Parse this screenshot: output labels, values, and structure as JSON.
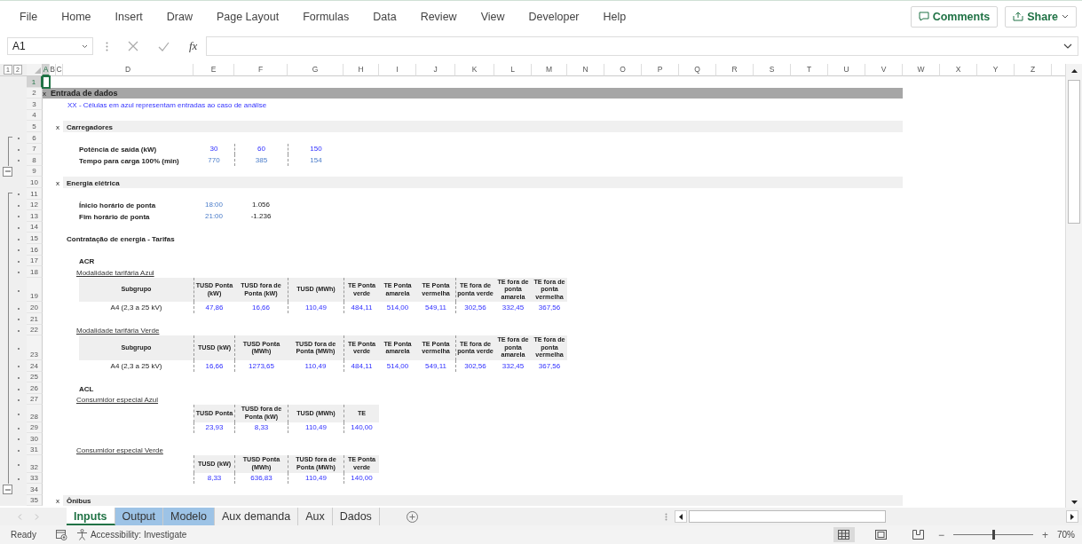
{
  "ribbon": {
    "tabs": [
      {
        "label": "File",
        "selected": false
      },
      {
        "label": "Home",
        "selected": false
      },
      {
        "label": "Insert",
        "selected": false
      },
      {
        "label": "Draw",
        "selected": false
      },
      {
        "label": "Page Layout",
        "selected": false
      },
      {
        "label": "Formulas",
        "selected": false
      },
      {
        "label": "Data",
        "selected": false
      },
      {
        "label": "Review",
        "selected": false
      },
      {
        "label": "View",
        "selected": false
      },
      {
        "label": "Developer",
        "selected": false
      },
      {
        "label": "Help",
        "selected": false
      }
    ],
    "comments": "Comments",
    "share": "Share"
  },
  "formula_bar": {
    "name_box": "A1",
    "function_label": "fx"
  },
  "sheet": {
    "outline_levels": [
      "1",
      "2"
    ],
    "columns": [
      {
        "label": "A",
        "selected": true
      },
      {
        "label": "B",
        "selected": false
      },
      {
        "label": "C",
        "selected": false
      },
      {
        "label": "D",
        "selected": false
      },
      {
        "label": "E",
        "selected": false
      },
      {
        "label": "F",
        "selected": false
      },
      {
        "label": "G",
        "selected": false
      },
      {
        "label": "H",
        "selected": false
      },
      {
        "label": "I",
        "selected": false
      },
      {
        "label": "J",
        "selected": false
      },
      {
        "label": "K",
        "selected": false
      },
      {
        "label": "L",
        "selected": false
      },
      {
        "label": "M",
        "selected": false
      },
      {
        "label": "N",
        "selected": false
      },
      {
        "label": "O",
        "selected": false
      },
      {
        "label": "P",
        "selected": false
      },
      {
        "label": "Q",
        "selected": false
      },
      {
        "label": "R",
        "selected": false
      },
      {
        "label": "S",
        "selected": false
      },
      {
        "label": "T",
        "selected": false
      },
      {
        "label": "U",
        "selected": false
      },
      {
        "label": "V",
        "selected": false
      },
      {
        "label": "W",
        "selected": false
      },
      {
        "label": "X",
        "selected": false
      },
      {
        "label": "Y",
        "selected": false
      },
      {
        "label": "Z",
        "selected": false
      }
    ],
    "rows": [
      {
        "number": "1",
        "selected": true
      },
      {
        "number": "2",
        "selected": false,
        "band": true,
        "cells": {
          "A": {
            "text": "x",
            "kind": "marker"
          },
          "B": {
            "text": "Entrada de dados",
            "kind": "title"
          }
        }
      },
      {
        "number": "3",
        "selected": false,
        "cells": {
          "D": {
            "text": "XX - Células em azul representam entradas ao caso de análise",
            "kind": "note"
          }
        }
      },
      {
        "number": "4",
        "selected": false
      },
      {
        "number": "5",
        "selected": false,
        "band": true,
        "cells": {
          "C": {
            "text": "x",
            "kind": "marker"
          },
          "D": {
            "text": "Carregadores",
            "kind": "heading"
          }
        }
      },
      {
        "number": "6",
        "selected": false,
        "grouped": true
      },
      {
        "number": "7",
        "selected": false,
        "grouped": true,
        "cells": {
          "D": {
            "text": "Potência de saída (kW)",
            "kind": "label",
            "indent": true
          },
          "E": {
            "text": "30",
            "kind": "input"
          },
          "F": {
            "text": "60",
            "kind": "input",
            "divider": true
          },
          "G": {
            "text": "150",
            "kind": "input",
            "divider": true
          }
        }
      },
      {
        "number": "8",
        "selected": false,
        "grouped": true,
        "cells": {
          "D": {
            "text": "Tempo para carga 100% (min)",
            "kind": "label",
            "indent": true
          },
          "E": {
            "text": "770",
            "kind": "calc"
          },
          "F": {
            "text": "385",
            "kind": "calc",
            "divider": true
          },
          "G": {
            "text": "154",
            "kind": "calc",
            "divider": true
          }
        }
      },
      {
        "number": "9",
        "selected": false,
        "group_toggle": true
      },
      {
        "number": "10",
        "selected": false,
        "band": true,
        "cells": {
          "C": {
            "text": "x",
            "kind": "marker"
          },
          "D": {
            "text": "Energia elétrica",
            "kind": "heading"
          }
        }
      },
      {
        "number": "11",
        "selected": false,
        "grouped": true
      },
      {
        "number": "12",
        "selected": false,
        "grouped": true,
        "cells": {
          "D": {
            "text": "Ínicio horário de ponta",
            "kind": "label",
            "indent": true
          },
          "E": {
            "text": "18:00",
            "kind": "calc"
          },
          "F": {
            "text": "1.056",
            "kind": "value"
          }
        }
      },
      {
        "number": "13",
        "selected": false,
        "grouped": true,
        "cells": {
          "D": {
            "text": "Fim horário de ponta",
            "kind": "label",
            "indent": true
          },
          "E": {
            "text": "21:00",
            "kind": "calc"
          },
          "F": {
            "text": "-1.236",
            "kind": "value"
          }
        }
      },
      {
        "number": "14",
        "selected": false,
        "grouped": true
      },
      {
        "number": "15",
        "selected": false,
        "grouped": true,
        "cells": {
          "D": {
            "text": "Contratação de energia - Tarifas",
            "kind": "heading"
          }
        }
      },
      {
        "number": "16",
        "selected": false,
        "grouped": true
      },
      {
        "number": "17",
        "selected": false,
        "grouped": true,
        "cells": {
          "D": {
            "text": "ACR",
            "kind": "heading",
            "indent": true
          }
        }
      },
      {
        "number": "18",
        "selected": false,
        "grouped": true,
        "cells": {
          "D": {
            "text": "Modalidade tarifária Azul",
            "kind": "link",
            "indent": true
          }
        }
      },
      {
        "number": "19",
        "selected": false,
        "grouped": true,
        "cells": {
          "D": {
            "text": "Subgrupo",
            "kind": "th",
            "indent": true
          },
          "E": {
            "text": "TUSD Ponta (kW)",
            "kind": "th",
            "divider": true
          },
          "F": {
            "text": "TUSD fora de Ponta (kW)",
            "kind": "th"
          },
          "G": {
            "text": "TUSD (MWh)",
            "kind": "th",
            "divider": true
          },
          "H": {
            "text": "TE Ponta verde",
            "kind": "th",
            "divider": true
          },
          "I": {
            "text": "TE Ponta amarela",
            "kind": "th"
          },
          "J": {
            "text": "TE Ponta vermelha",
            "kind": "th"
          },
          "K": {
            "text": "TE fora de ponta verde",
            "kind": "th",
            "divider": true
          },
          "L": {
            "text": "TE fora de ponta amarela",
            "kind": "th"
          },
          "M": {
            "text": "TE fora de ponta vermelha",
            "kind": "th"
          }
        }
      },
      {
        "number": "20",
        "selected": false,
        "grouped": true,
        "cells": {
          "D": {
            "text": "A4 (2,3 a 25 kV)",
            "kind": "subgroup",
            "indent": true
          },
          "E": {
            "text": "47,86",
            "kind": "td",
            "divider": true
          },
          "F": {
            "text": "16,66",
            "kind": "td"
          },
          "G": {
            "text": "110,49",
            "kind": "td",
            "divider": true
          },
          "H": {
            "text": "484,11",
            "kind": "td",
            "divider": true
          },
          "I": {
            "text": "514,00",
            "kind": "td"
          },
          "J": {
            "text": "549,11",
            "kind": "td"
          },
          "K": {
            "text": "302,56",
            "kind": "td",
            "divider": true
          },
          "L": {
            "text": "332,45",
            "kind": "td"
          },
          "M": {
            "text": "367,56",
            "kind": "td"
          }
        }
      },
      {
        "number": "21",
        "selected": false,
        "grouped": true
      },
      {
        "number": "22",
        "selected": false,
        "grouped": true,
        "cells": {
          "D": {
            "text": "Modalidade tarifária Verde",
            "kind": "link",
            "indent": true
          }
        }
      },
      {
        "number": "23",
        "selected": false,
        "grouped": true,
        "cells": {
          "D": {
            "text": "Subgrupo",
            "kind": "th",
            "indent": true
          },
          "E": {
            "text": "TUSD (kW)",
            "kind": "th",
            "divider": true
          },
          "F": {
            "text": "TUSD Ponta (MWh)",
            "kind": "th",
            "divider": true
          },
          "G": {
            "text": "TUSD fora de Ponta (MWh)",
            "kind": "th"
          },
          "H": {
            "text": "TE Ponta verde",
            "kind": "th",
            "divider": true
          },
          "I": {
            "text": "TE Ponta amarela",
            "kind": "th"
          },
          "J": {
            "text": "TE Ponta vermelha",
            "kind": "th"
          },
          "K": {
            "text": "TE fora de ponta verde",
            "kind": "th",
            "divider": true
          },
          "L": {
            "text": "TE fora de ponta amarela",
            "kind": "th"
          },
          "M": {
            "text": "TE fora de ponta vermelha",
            "kind": "th"
          }
        }
      },
      {
        "number": "24",
        "selected": false,
        "grouped": true,
        "cells": {
          "D": {
            "text": "A4 (2,3 a 25 kV)",
            "kind": "subgroup",
            "indent": true
          },
          "E": {
            "text": "16,66",
            "kind": "td",
            "divider": true
          },
          "F": {
            "text": "1273,65",
            "kind": "td",
            "divider": true
          },
          "G": {
            "text": "110,49",
            "kind": "td"
          },
          "H": {
            "text": "484,11",
            "kind": "td",
            "divider": true
          },
          "I": {
            "text": "514,00",
            "kind": "td"
          },
          "J": {
            "text": "549,11",
            "kind": "td"
          },
          "K": {
            "text": "302,56",
            "kind": "td",
            "divider": true
          },
          "L": {
            "text": "332,45",
            "kind": "td"
          },
          "M": {
            "text": "367,56",
            "kind": "td"
          }
        }
      },
      {
        "number": "25",
        "selected": false,
        "grouped": true
      },
      {
        "number": "26",
        "selected": false,
        "grouped": true,
        "cells": {
          "D": {
            "text": "ACL",
            "kind": "heading",
            "indent": true
          }
        }
      },
      {
        "number": "27",
        "selected": false,
        "grouped": true,
        "cells": {
          "D": {
            "text": "Consumidor especial Azul",
            "kind": "link",
            "indent": true
          }
        }
      },
      {
        "number": "28",
        "selected": false,
        "grouped": true,
        "cells": {
          "E": {
            "text": "TUSD Ponta",
            "kind": "th",
            "divider": true
          },
          "F": {
            "text": "TUSD fora de Ponta (kW)",
            "kind": "th",
            "divider": true
          },
          "G": {
            "text": "TUSD (MWh)",
            "kind": "th",
            "divider": true
          },
          "H": {
            "text": "TE",
            "kind": "th",
            "divider": true
          }
        }
      },
      {
        "number": "29",
        "selected": false,
        "grouped": true,
        "cells": {
          "E": {
            "text": "23,93",
            "kind": "td",
            "divider": true
          },
          "F": {
            "text": "8,33",
            "kind": "td",
            "divider": true
          },
          "G": {
            "text": "110,49",
            "kind": "td",
            "divider": true
          },
          "H": {
            "text": "140,00",
            "kind": "td",
            "divider": true
          }
        }
      },
      {
        "number": "30",
        "selected": false,
        "grouped": true
      },
      {
        "number": "31",
        "selected": false,
        "grouped": true,
        "cells": {
          "D": {
            "text": "Consumidor especial Verde",
            "kind": "link",
            "indent": true
          }
        }
      },
      {
        "number": "32",
        "selected": false,
        "grouped": true,
        "cells": {
          "E": {
            "text": "TUSD (kW)",
            "kind": "th",
            "divider": true
          },
          "F": {
            "text": "TUSD Ponta (MWh)",
            "kind": "th",
            "divider": true
          },
          "G": {
            "text": "TUSD fora de Ponta (MWh)",
            "kind": "th",
            "divider": true
          },
          "H": {
            "text": "TE Ponta verde",
            "kind": "th",
            "divider": true
          }
        }
      },
      {
        "number": "33",
        "selected": false,
        "grouped": true,
        "cells": {
          "E": {
            "text": "8,33",
            "kind": "td",
            "divider": true
          },
          "F": {
            "text": "636,83",
            "kind": "td",
            "divider": true
          },
          "G": {
            "text": "110,49",
            "kind": "td",
            "divider": true
          },
          "H": {
            "text": "140,00",
            "kind": "td",
            "divider": true
          }
        }
      },
      {
        "number": "34",
        "selected": false,
        "group_toggle": true
      },
      {
        "number": "35",
        "selected": false,
        "band": true,
        "cells": {
          "C": {
            "text": "x",
            "kind": "marker"
          },
          "D": {
            "text": "Ônibus",
            "kind": "heading"
          }
        }
      }
    ]
  },
  "sheet_tabs": [
    {
      "label": "Inputs",
      "selected": true
    },
    {
      "label": "Output",
      "selected": false,
      "color": "#9dc3e6"
    },
    {
      "label": "Modelo",
      "selected": false,
      "color": "#9dc3e6"
    },
    {
      "label": "Aux demanda",
      "selected": false
    },
    {
      "label": "Aux",
      "selected": false
    },
    {
      "label": "Dados",
      "selected": false
    }
  ],
  "status_bar": {
    "status": "Ready",
    "accessibility": "Accessibility: Investigate",
    "views": [
      {
        "kind": "normal",
        "selected": true
      },
      {
        "kind": "page-layout",
        "selected": false
      },
      {
        "kind": "page-break",
        "selected": false
      }
    ],
    "zoom": {
      "minus": "−",
      "plus": "+",
      "level": 0.5,
      "reading": "70%"
    }
  }
}
